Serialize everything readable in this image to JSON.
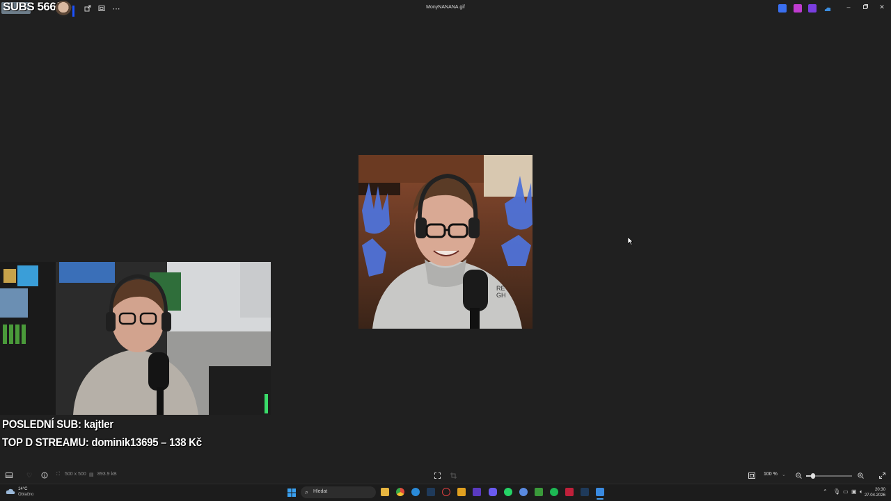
{
  "window": {
    "title": "MonyNANANA.gif"
  },
  "overlay": {
    "subs_counter": "SUBS 566/",
    "last_sub": "POSLEDNÍ SUB: kajtler",
    "top_donation": "TOP D STREAMU: dominik13695 – 138 Kč"
  },
  "statusbar": {
    "dimensions": "500 x 500",
    "file_size": "893.9 kB",
    "zoom_level": "100 %",
    "zoom_slider_fraction": 0.15
  },
  "taskbar": {
    "weather_temp": "14°C",
    "weather_condition": "Oblačno",
    "search_label": "Hledat",
    "time": "20:30",
    "date": "27.04.2026"
  },
  "colors": {
    "background": "#202020",
    "taskbar": "#1c1c1c",
    "accent_blue": "#1b52ff"
  },
  "icons": {
    "titlebar": [
      "app-icon",
      "share-icon",
      "slideshow-icon",
      "more-icon"
    ],
    "statusbar": [
      "film-strip-icon",
      "favorite-heart-icon",
      "info-icon",
      "dimensions-icon",
      "file-size-icon",
      "fit-icon",
      "crop-icon",
      "fit-window-icon",
      "zoom-out-icon",
      "zoom-in-icon",
      "fullscreen-icon"
    ]
  }
}
